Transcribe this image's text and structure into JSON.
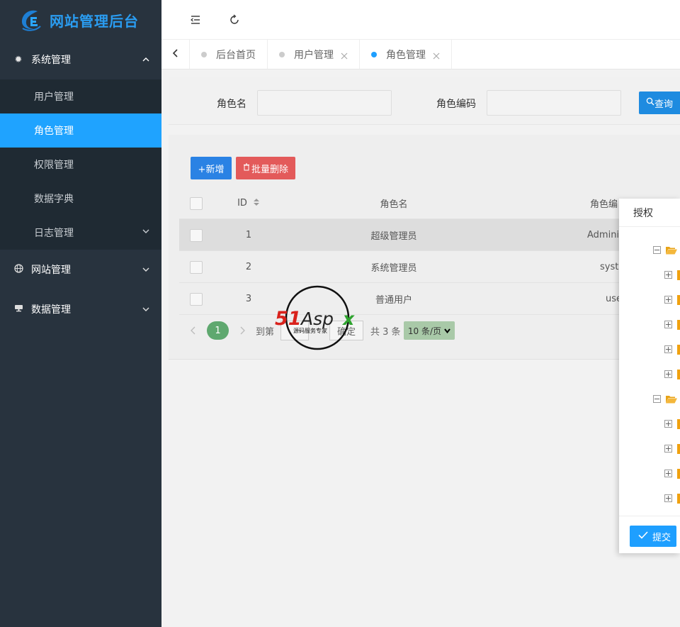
{
  "app": {
    "title": "网站管理后台"
  },
  "sidebar": {
    "groups": [
      {
        "label": "系统管理",
        "icon": "gear-icon",
        "expanded": true,
        "items": [
          {
            "label": "用户管理"
          },
          {
            "label": "角色管理",
            "active": true
          },
          {
            "label": "权限管理"
          },
          {
            "label": "数据字典"
          },
          {
            "label": "日志管理",
            "has_children": true
          }
        ]
      },
      {
        "label": "网站管理",
        "icon": "globe-icon",
        "expanded": false
      },
      {
        "label": "数据管理",
        "icon": "monitor-icon",
        "expanded": false
      }
    ]
  },
  "tabs": [
    {
      "label": "后台首页",
      "closable": false,
      "active": false
    },
    {
      "label": "用户管理",
      "closable": true,
      "active": false
    },
    {
      "label": "角色管理",
      "closable": true,
      "active": true
    }
  ],
  "search": {
    "role_name_label": "角色名",
    "role_name_value": "",
    "role_code_label": "角色编码",
    "role_code_value": "",
    "query_label": "查询"
  },
  "toolbar": {
    "add_label": "+新增",
    "batch_delete_label": "批量删除"
  },
  "table": {
    "columns": [
      "ID",
      "角色名",
      "角色编"
    ],
    "rows": [
      {
        "id": "1",
        "name": "超级管理员",
        "code": "Adminis",
        "highlighted": true
      },
      {
        "id": "2",
        "name": "系统管理员",
        "code": "syste",
        "highlighted": false
      },
      {
        "id": "3",
        "name": "普通用户",
        "code": "use",
        "highlighted": false
      }
    ]
  },
  "pagination": {
    "current_page": "1",
    "goto_label": "到第",
    "confirm_label": "确定",
    "total_label": "共 3 条",
    "page_size_label": "10 条/页"
  },
  "watermark": {
    "brand": "51Aspx",
    "tagline": "源码服务专家"
  },
  "dialog": {
    "title": "授权",
    "submit_label": "提交",
    "tree": [
      {
        "type": "folder",
        "expanded": true
      },
      {
        "type": "node"
      },
      {
        "type": "node"
      },
      {
        "type": "node"
      },
      {
        "type": "node"
      },
      {
        "type": "node"
      },
      {
        "type": "folder",
        "expanded": true
      },
      {
        "type": "node"
      },
      {
        "type": "node"
      },
      {
        "type": "node"
      },
      {
        "type": "node"
      }
    ]
  },
  "colors": {
    "sidebar_bg": "#28333e",
    "submenu_bg": "#1f2a33",
    "accent": "#1fa3ff",
    "brand": "#2a9cf0",
    "danger": "#e35a5a",
    "pager_current": "#5fa86f"
  }
}
